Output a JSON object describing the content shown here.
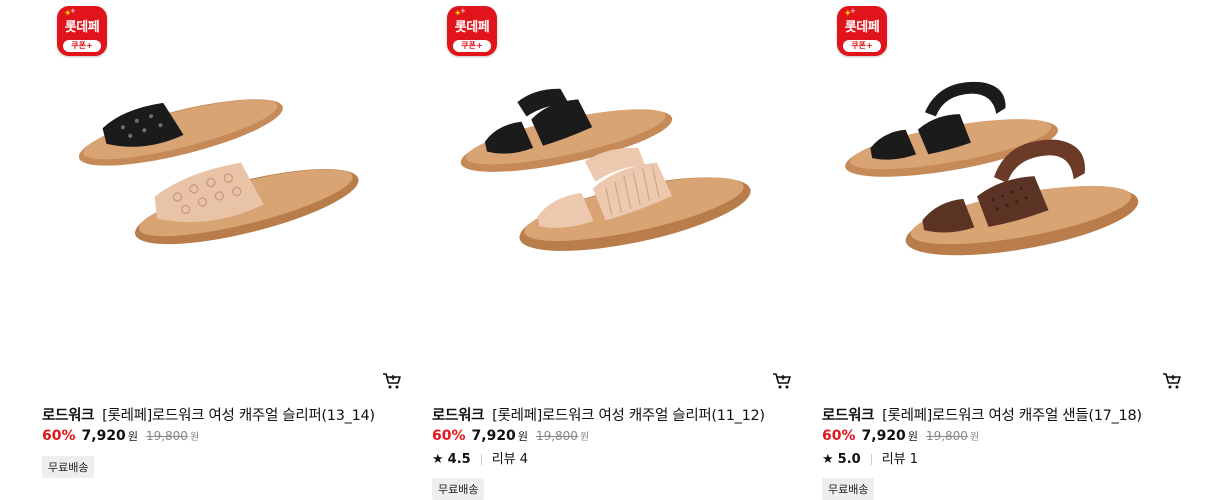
{
  "products": [
    {
      "badge": {
        "top": "롯데페",
        "bottom": "쿠폰+"
      },
      "brand": "로드워크",
      "title": "[롯레페]로드워크 여성 캐주얼 슬리퍼(13_14)",
      "discount": "60%",
      "price": "7,920",
      "price_unit": "원",
      "original_price": "19,800",
      "original_unit": "원",
      "shipping": "무료배송",
      "colors": [
        "#1a1a1a",
        "#e9c7ad"
      ]
    },
    {
      "badge": {
        "top": "롯데페",
        "bottom": "쿠폰+"
      },
      "brand": "로드워크",
      "title": "[롯레페]로드워크 여성 캐주얼 슬리퍼(11_12)",
      "discount": "60%",
      "price": "7,920",
      "price_unit": "원",
      "original_price": "19,800",
      "original_unit": "원",
      "rating": "4.5",
      "reviews": "리뷰 4",
      "shipping": "무료배송",
      "colors": [
        "#1a1a1a",
        "#ecc9b0"
      ]
    },
    {
      "badge": {
        "top": "롯데페",
        "bottom": "쿠폰+"
      },
      "brand": "로드워크",
      "title": "[롯레페]로드워크 여성 캐주얼 샌들(17_18)",
      "discount": "60%",
      "price": "7,920",
      "price_unit": "원",
      "original_price": "19,800",
      "original_unit": "원",
      "rating": "5.0",
      "reviews": "리뷰 1",
      "shipping": "무료배송",
      "colors": [
        "#1a1a1a",
        "#5a3324"
      ]
    }
  ],
  "accent_color": "#e3141a",
  "icons": {
    "cart": "cart-icon",
    "star": "star-icon",
    "badge": "lottepay-coupon-badge"
  }
}
